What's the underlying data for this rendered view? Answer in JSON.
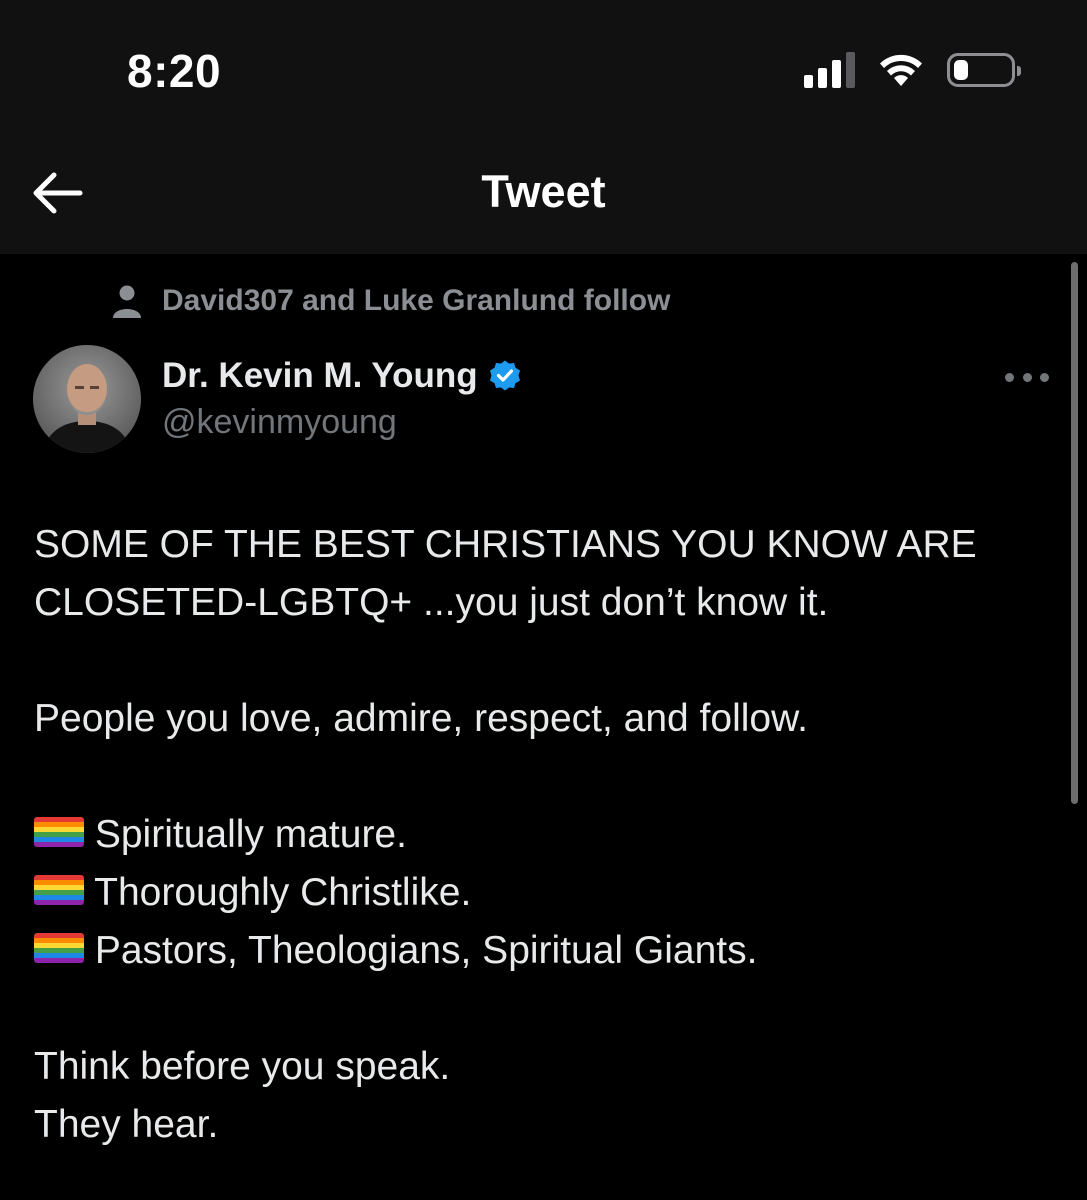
{
  "status_bar": {
    "time": "8:20",
    "signal_bars": 3,
    "battery_level": 0.25,
    "icons": [
      "cellular-signal-icon",
      "wifi-icon",
      "battery-icon"
    ]
  },
  "header": {
    "title": "Tweet",
    "back_icon": "arrow-left-icon"
  },
  "tweet": {
    "social_context": "David307 and Luke Granlund follow",
    "author": {
      "display_name": "Dr. Kevin M. Young",
      "handle": "@kevinmyoung",
      "verified": true
    },
    "body": {
      "p1_line1": "SOME OF THE BEST CHRISTIANS YOU KNOW ARE",
      "p1_line2": "CLOSETED-LGBTQ+ ...you just don’t know it.",
      "p2": "People you love, admire, respect, and follow.",
      "bullets": [
        "Spiritually mature.",
        "Thoroughly Christlike.",
        "Pastors, Theologians, Spiritual Giants."
      ],
      "p4_line1": "Think before you speak.",
      "p4_line2": "They hear."
    }
  },
  "colors": {
    "background": "#000000",
    "header_background": "#111111",
    "text_primary": "#e7e9ea",
    "text_secondary": "#71767b",
    "verified_blue": "#1d9bf0",
    "rainbow": [
      "#e53935",
      "#fb8c00",
      "#fdd835",
      "#43a047",
      "#1e88e5",
      "#8e24aa"
    ]
  }
}
